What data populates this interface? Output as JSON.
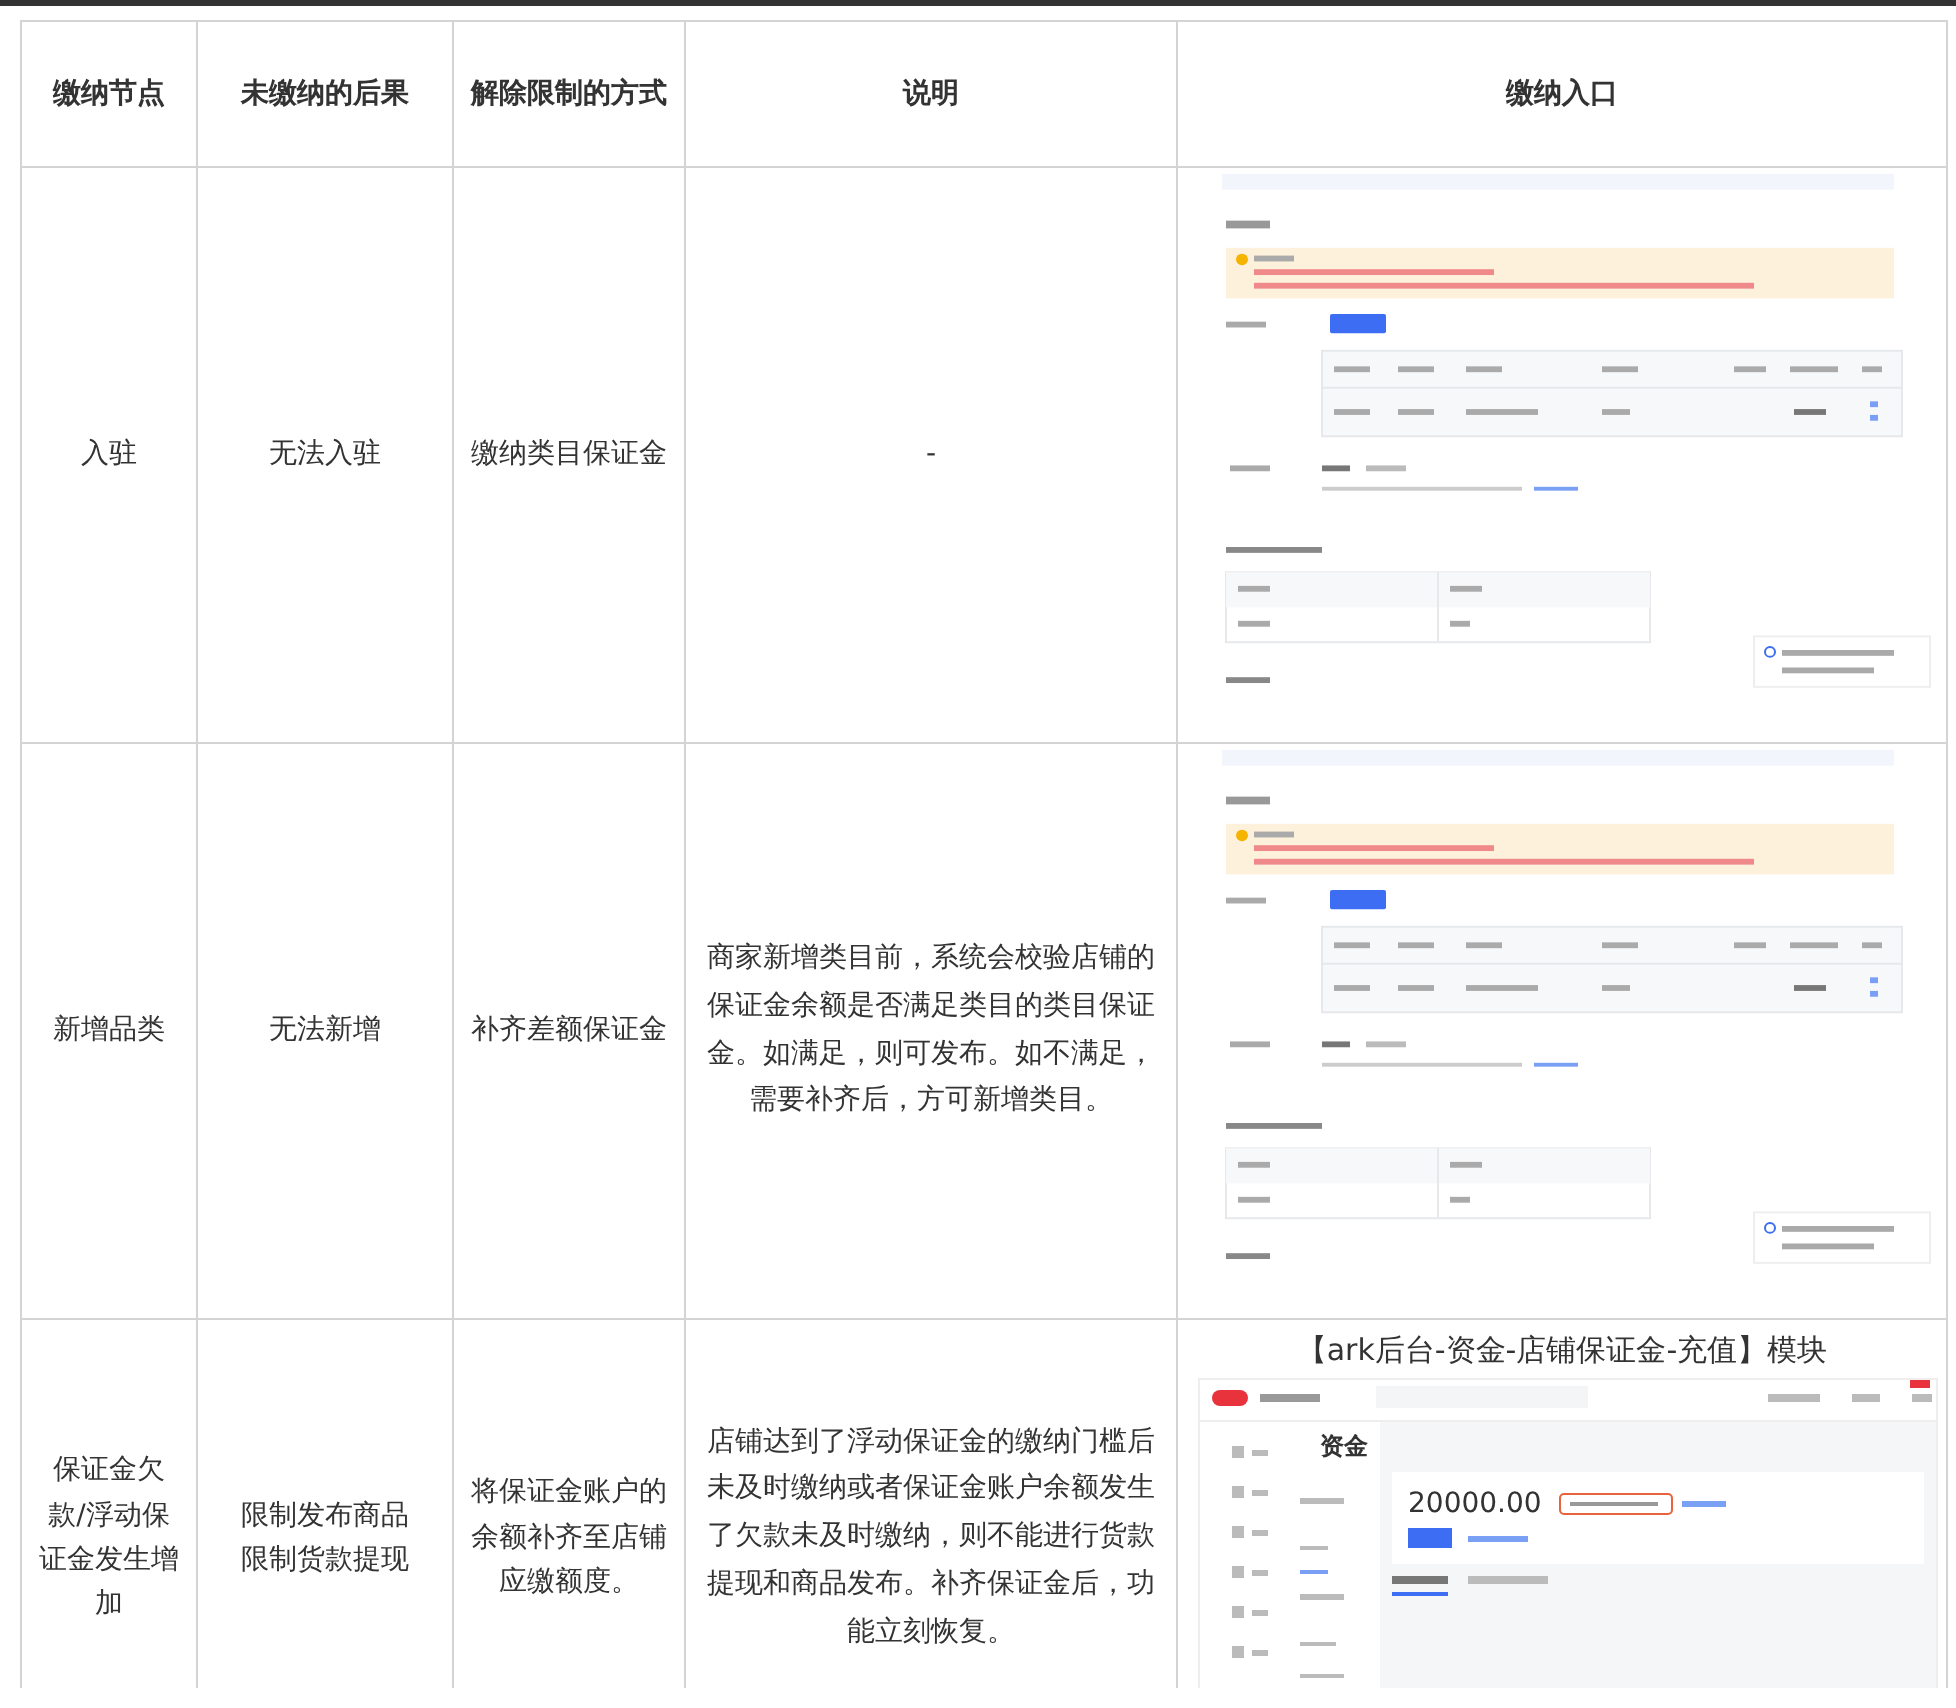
{
  "table": {
    "columns": [
      "缴纳节点",
      "未缴纳的后果",
      "解除限制的方式",
      "说明",
      "缴纳入口"
    ],
    "rows": [
      {
        "cells": [
          "入驻",
          "无法入驻",
          "缴纳类目保证金",
          "-"
        ],
        "entry": {
          "kind": "form_screenshot"
        }
      },
      {
        "cells": [
          "新增品类",
          "无法新增",
          "补齐差额保证金",
          "商家新增类目前，系统会校验店铺的保证金余额是否满足类目的类目保证金。如满足，则可发布。如不满足，需要补齐后，方可新增类目。"
        ],
        "entry": {
          "kind": "form_screenshot"
        }
      },
      {
        "cells": [
          "保证金欠款/浮动保证金发生增加",
          [
            "限制发布商品",
            "限制货款提现"
          ],
          "将保证金账户的余额补齐至店铺应缴额度。",
          "店铺达到了浮动保证金的缴纳门槛后未及时缴纳或者保证金账户余额发生了欠款未及时缴纳，则不能进行货款提现和商品发布。补齐保证金后，功能立刻恢复。"
        ],
        "entry": {
          "kind": "dashboard_screenshot",
          "caption": "【ark后台-资金-店铺保证金-充值】模块",
          "section": "资金",
          "amount": "20000.00"
        }
      }
    ]
  }
}
